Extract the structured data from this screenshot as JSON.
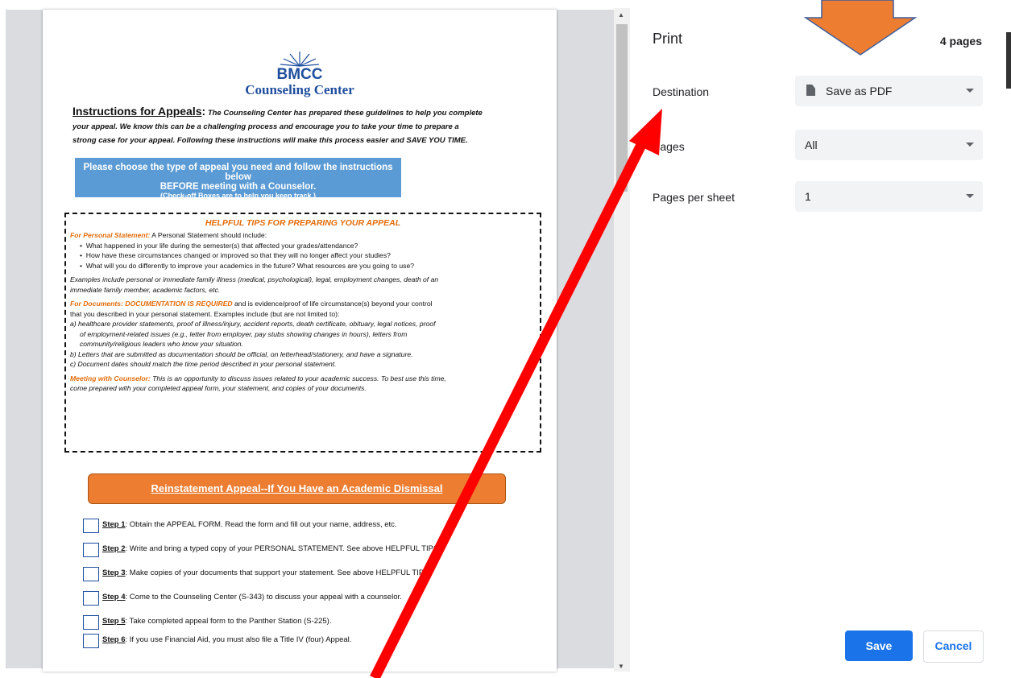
{
  "print": {
    "title": "Print",
    "pages_count": "4 pages",
    "destination": {
      "label": "Destination",
      "value": "Save as PDF"
    },
    "pages": {
      "label": "Pages",
      "value": "All"
    },
    "pages_per_sheet": {
      "label": "Pages per sheet",
      "value": "1"
    },
    "save_label": "Save",
    "cancel_label": "Cancel"
  },
  "document": {
    "logo_text": "BMCC",
    "logo_subtitle": "Counseling Center",
    "intro_heading": "Instructions for Appeals",
    "intro_lines": [
      "The Counseling Center has prepared these guidelines to help you complete",
      "your appeal. We know this can be a challenging process and encourage you to take your time to prepare a",
      "strong case for your appeal. Following these instructions will make this process easier and SAVE YOU TIME."
    ],
    "choose_line1": "Please choose the type of appeal you need and follow the instructions below",
    "choose_line2": "BEFORE meeting with a Counselor.",
    "choose_line3": "(Check-off Boxes are to help you keep track.)",
    "tips_title": "HELPFUL TIPS FOR PREPARING YOUR APPEAL",
    "personal_label": "For Personal Statement:",
    "personal_text": "A Personal Statement should include:",
    "bullets": [
      "What happened in your life during the semester(s) that affected your grades/attendance?",
      "How have these circumstances changed or improved so that they will no longer affect your studies?",
      "What will you do differently to improve your academics in the future? What resources are you going to use?"
    ],
    "examples_line1": "Examples include personal or immediate family illness (medical, psychological), legal, employment changes, death of an",
    "examples_line2": "immediate family member, academic factors, etc.",
    "docs_label": "For Documents: DOCUMENTATION IS REQUIRED",
    "docs_text1": "and is evidence/proof of life circumstance(s) beyond your control",
    "docs_text2": "that you described in your personal statement. Examples include (but are not limited to):",
    "docs_a1": "a)  healthcare provider statements, proof of illness/injury, accident reports, death certificate, obituary, legal notices, proof",
    "docs_a2": "of employment-related issues (e.g., letter from employer, pay stubs showing changes in hours), letters from",
    "docs_a3": "community/religious leaders who know your situation.",
    "docs_b": "b)  Letters that are submitted as documentation should be official, on letterhead/stationery, and have a signature.",
    "docs_c": "c)  Document dates should match the time period described in your personal statement.",
    "meeting_label": "Meeting with Counselor:",
    "meeting_text1": "This is an opportunity to discuss issues related to your academic success. To best use this time,",
    "meeting_text2": "come prepared with your completed appeal form, your statement, and copies of your documents.",
    "reinstatement": "Reinstatement Appeal--If You Have an Academic Dismissal",
    "steps": [
      {
        "num": "Step 1",
        "text": ": Obtain the APPEAL FORM. Read the form and fill out your name, address, etc."
      },
      {
        "num": "Step 2",
        "text": ": Write and bring a typed copy of your PERSONAL STATEMENT. See above HELPFUL TIPS."
      },
      {
        "num": "Step 3",
        "text": ": Make copies of your documents that support your statement. See above HELPFUL TIPS."
      },
      {
        "num": "Step 4",
        "text": ": Come to the Counseling Center (S-343) to discuss your appeal with a counselor."
      },
      {
        "num": "Step 5",
        "text": ": Take completed appeal form to the Panther Station (S-225)."
      },
      {
        "num": "Step 6",
        "text": ": If you use Financial Aid, you must also file a Title IV (four) Appeal."
      }
    ]
  },
  "annotations": {
    "arrow_orange_color": "#ed7d31",
    "arrow_orange_border": "#3f5f9f",
    "arrow_red_color": "#ff0000"
  }
}
